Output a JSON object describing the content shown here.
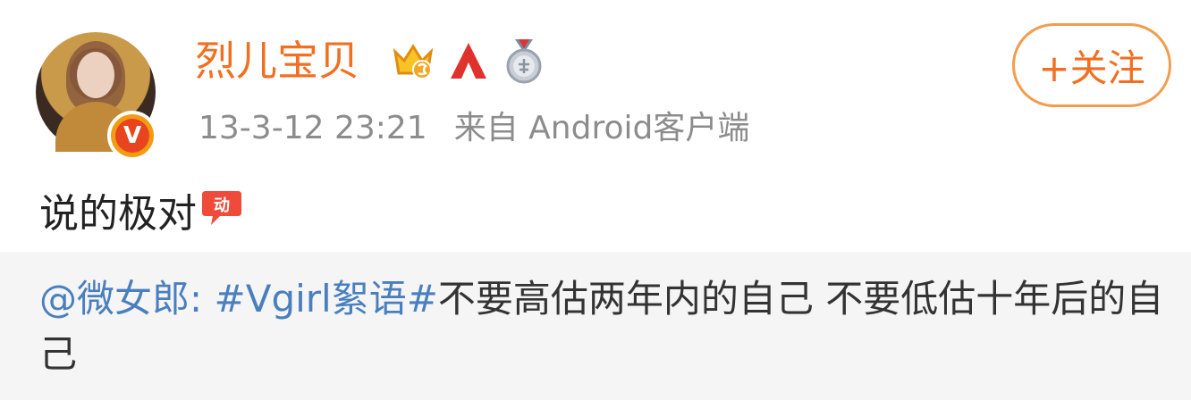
{
  "post": {
    "username": "烈儿宝贝",
    "timestamp": "13-3-12 23:21",
    "source": "来自 Android客户端",
    "follow_label": "+关注",
    "text": "说的极对",
    "emoji_name": "xiaomi-emoji-icon",
    "avatar_badge": "V",
    "badges": [
      "crown-vip-icon",
      "red-triangle-icon",
      "silver-medal-icon"
    ]
  },
  "repost": {
    "mention": "@微女郎",
    "colon": ": ",
    "hashtag": "#Vgirl絮语#",
    "content": "不要高估两年内的自己 不要低估十年后的自己"
  },
  "colors": {
    "username": "#f26f21",
    "link": "#4a7fbf",
    "meta": "#8c8c8c",
    "repost_bg": "#f5f5f5"
  }
}
